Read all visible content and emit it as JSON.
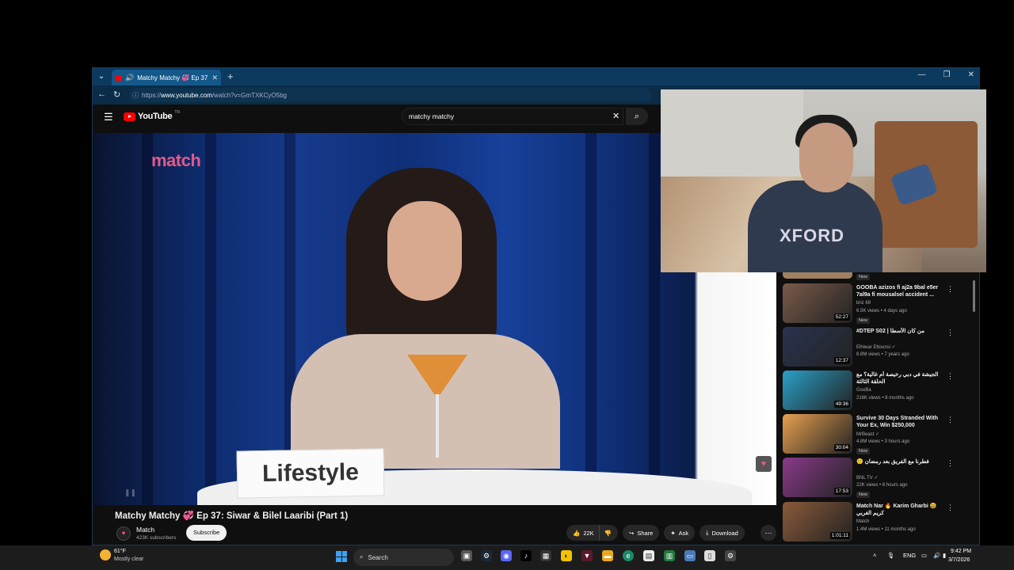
{
  "browser": {
    "tab_title": "Matchy Matchy 💞 Ep 37: Siwar & Bilel Laaribi (Part 1)",
    "url_prefix": "https://",
    "url_domain": "www.youtube.com",
    "url_path": "/watch?v=GmTXKCyO5bg"
  },
  "youtube": {
    "logo_text": "YouTube",
    "logo_region": "TN",
    "search_query": "matchy matchy"
  },
  "video": {
    "brand_overlay": "match",
    "name_card": "Lifestyle",
    "title": "Matchy Matchy 💞 Ep 37: Siwar & Bilel Laaribi (Part 1)",
    "channel": "Match",
    "subscribers": "423K subscribers",
    "subscribe_label": "Subscribe",
    "likes": "22K",
    "share_label": "Share",
    "ask_label": "Ask",
    "download_label": "Download"
  },
  "sidebar": {
    "first_badge": "New",
    "items": [
      {
        "title": "GOOBA azizos fi aj2a 9bal e5er 7al9a fi mousalsel accident ...",
        "channel": "briz 69",
        "meta": "6.5K views • 4 days ago",
        "badge": "New",
        "duration": "52:27",
        "color": "#7a5a4a"
      },
      {
        "title": "#DTEP S02 | من كان الأسطا",
        "channel": "Elhiwar Ettounsi ✓",
        "meta": "8.8M views • 7 years ago",
        "badge": "",
        "duration": "12:37",
        "color": "#2a3350"
      },
      {
        "title": "الجيشة في دبي رخيصة أم غالية؟ مع الحلقة الثالثة",
        "channel": "GooBa",
        "meta": "216K views • 8 months ago",
        "badge": "",
        "duration": "49:36",
        "color": "#2aa0c8"
      },
      {
        "title": "Survive 30 Days Stranded With Your Ex, Win $250,000",
        "channel": "MrBeast ✓",
        "meta": "4.8M views • 3 hours ago",
        "badge": "New",
        "duration": "30:04",
        "color": "#e8a050"
      },
      {
        "title": "🙂 فطرنا مع الفريق بعد رمضان",
        "channel": "BNL TV ✓",
        "meta": "22K views • 8 hours ago",
        "badge": "New",
        "duration": "17:53",
        "color": "#8a3a8a"
      },
      {
        "title": "Match Nar 🔥 Karim Gharbi 😃 كريم الغربي",
        "channel": "Match",
        "meta": "1.4M views • 11 months ago",
        "badge": "",
        "duration": "1:01:11",
        "color": "#8a5a3a"
      }
    ]
  },
  "webcam": {
    "shirt_text": "XFORD"
  },
  "taskbar": {
    "temperature": "61°F",
    "weather": "Mostly clear",
    "search_label": "Search",
    "language": "ENG",
    "time": "9:42 PM",
    "date": "3/7/2026"
  },
  "colors": {
    "youtube_red": "#ff0000",
    "match_pink": "#e25a8a",
    "tab_blue": "#14588a"
  }
}
